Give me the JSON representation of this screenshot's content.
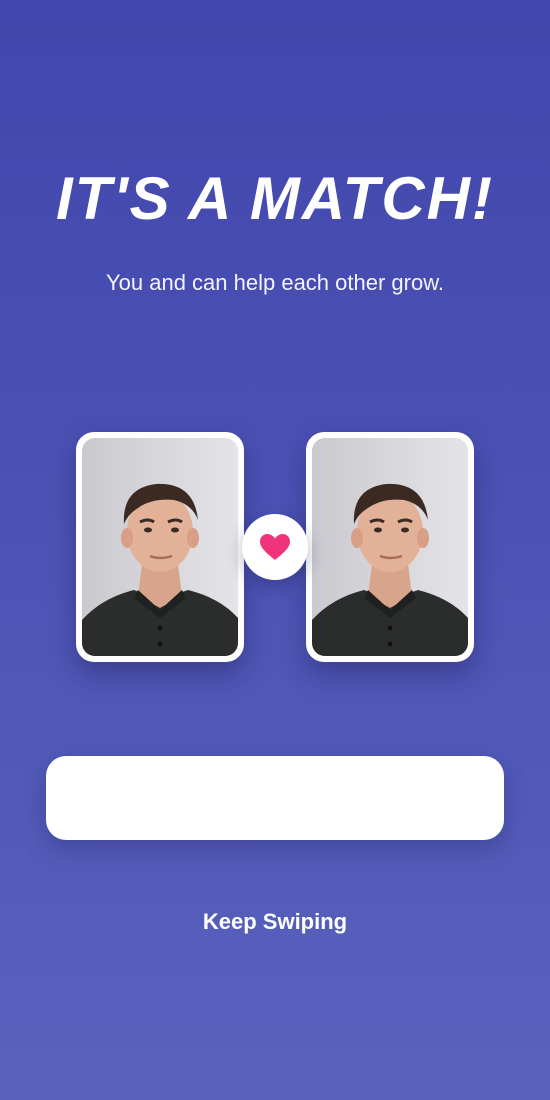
{
  "match": {
    "title": "IT'S A MATCH!",
    "subtitle": "You and  can help each other grow."
  },
  "icons": {
    "heart": "heart-icon"
  },
  "colors": {
    "background_top": "#4146ac",
    "background_bottom": "#5962bd",
    "heart": "#f0337a",
    "card": "#ffffff"
  },
  "message": {
    "value": ""
  },
  "actions": {
    "keep_swiping_label": "Keep Swiping"
  }
}
